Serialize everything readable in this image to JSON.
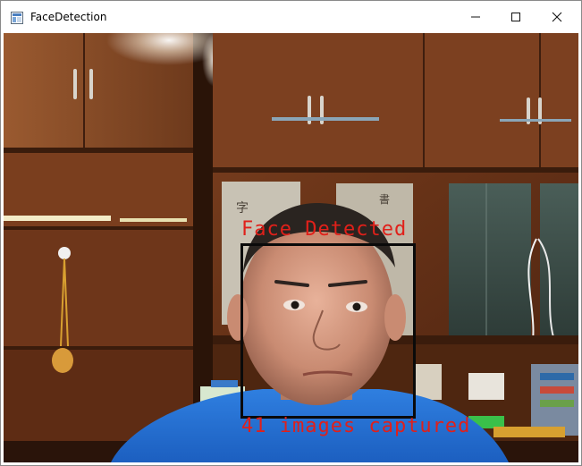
{
  "window": {
    "title": "FaceDetection",
    "app_icon": "opencv-window-icon",
    "controls": {
      "minimize_icon": "minimize-icon",
      "maximize_icon": "maximize-icon",
      "close_icon": "close-icon"
    }
  },
  "video": {
    "status_text": "Face Detected",
    "capture_text": "41 images captured",
    "overlay_color": "#e0201a",
    "box_color": "#0a0a0a"
  }
}
